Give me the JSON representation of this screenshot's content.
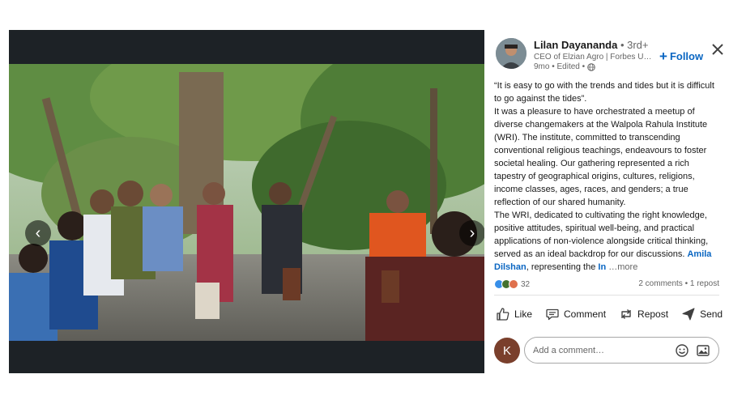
{
  "author": {
    "name": "Lilan Dayananda",
    "degree": "• 3rd+",
    "headline": "CEO of Elzian Agro | Forbes Under 30",
    "time": "9mo • Edited •"
  },
  "follow": {
    "plus": "+",
    "label": "Follow"
  },
  "post": {
    "quote": "“It is easy to go with the trends and tides but it is difficult to go against the tides”.",
    "para1": "It was a pleasure to have orchestrated a meetup of diverse changemakers at the Walpola Rahula Institute (WRI). The institute, committed to transcending conventional religious teachings, endeavours to foster societal healing. Our gathering represented a rich tapestry of geographical origins, cultures, religions, income classes, ages, races, and genders; a true reflection of our shared humanity.",
    "para2_start": "The WRI, dedicated to cultivating the right knowledge, positive attitudes, spiritual well-being, and practical applications of non-violence alongside critical thinking, served as an ideal backdrop for our discussions. ",
    "mention": "Amila Dilshan",
    "para2_end": ", representing the ",
    "mention2": "In",
    "more": " …more"
  },
  "social": {
    "reaction_count": "32",
    "stats": "2 comments • 1 repost"
  },
  "actions": {
    "like": "Like",
    "comment": "Comment",
    "repost": "Repost",
    "send": "Send"
  },
  "comment": {
    "avatar_letter": "K",
    "placeholder": "Add a comment…"
  },
  "colors": {
    "accent": "#0a66c2",
    "media_bg": "#1d2226"
  },
  "icons": [
    "chevron-left-icon",
    "chevron-right-icon",
    "close-icon",
    "globe-icon",
    "like-icon",
    "comment-icon",
    "repost-icon",
    "send-icon",
    "emoji-icon",
    "image-icon"
  ]
}
